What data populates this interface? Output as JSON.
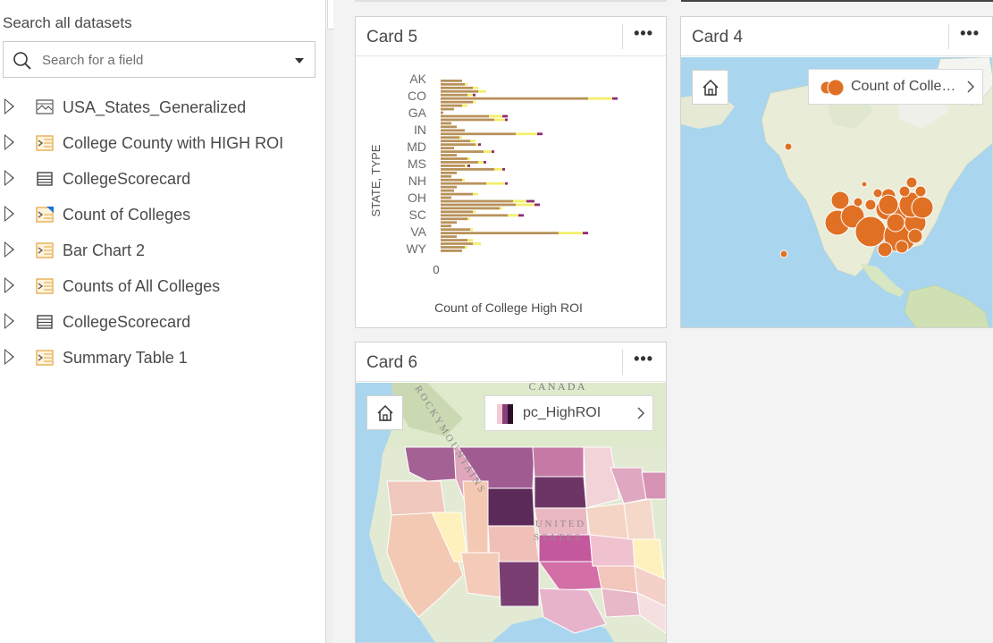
{
  "data_panel": {
    "title": "Search all datasets",
    "search": {
      "placeholder": "Search for a field"
    },
    "datasets": [
      {
        "label": "USA_States_Generalized",
        "icon": "map-layer-icon"
      },
      {
        "label": "College County with HIGH ROI",
        "icon": "result-dataset-icon"
      },
      {
        "label": "CollegeScorecard",
        "icon": "table-dataset-icon"
      },
      {
        "label": "Count of Colleges",
        "icon": "spatial-result-icon"
      },
      {
        "label": "Bar Chart 2",
        "icon": "result-dataset-icon"
      },
      {
        "label": "Counts of All Colleges",
        "icon": "result-dataset-icon"
      },
      {
        "label": "CollegeScorecard",
        "icon": "table-dataset-icon"
      },
      {
        "label": "Summary Table 1",
        "icon": "result-dataset-icon"
      }
    ]
  },
  "cards": {
    "card5": {
      "title": "Card 5",
      "menu": "•••"
    },
    "card4": {
      "title": "Card 4",
      "menu": "•••",
      "legend": "Count of Colle…"
    },
    "card6": {
      "title": "Card 6",
      "menu": "•••",
      "legend": "pc_HighROI"
    }
  },
  "map_labels": {
    "canada": "C A N A D A",
    "united_states": "U N I T E D",
    "states": "S T A T E S",
    "rocky": "R O C K Y   M O U N T A I N S"
  },
  "chart_data": {
    "type": "bar",
    "orientation": "horizontal",
    "stacked": true,
    "xlabel": "Count of College High ROI",
    "ylabel": "STATE, TYPE",
    "x_ticks": [
      "0"
    ],
    "y_tick_labels": [
      "AK",
      "CO",
      "GA",
      "IN",
      "MD",
      "MS",
      "NH",
      "OH",
      "SC",
      "VA",
      "WY"
    ],
    "colors": {
      "primary": "#b8915a",
      "secondary": "#f3ef6a",
      "tertiary": "#8e2a7a"
    },
    "series_values": [
      [
        8,
        0,
        0
      ],
      [
        9,
        1,
        0
      ],
      [
        12,
        2,
        0
      ],
      [
        14,
        3,
        0
      ],
      [
        10,
        2,
        1
      ],
      [
        55,
        9,
        2
      ],
      [
        12,
        1,
        0
      ],
      [
        8,
        2,
        0
      ],
      [
        5,
        0,
        0
      ],
      [
        1,
        0,
        0
      ],
      [
        18,
        5,
        2
      ],
      [
        20,
        4,
        1
      ],
      [
        4,
        0,
        0
      ],
      [
        6,
        0,
        0
      ],
      [
        9,
        0,
        0
      ],
      [
        28,
        8,
        2
      ],
      [
        7,
        1,
        0
      ],
      [
        11,
        2,
        0
      ],
      [
        13,
        1,
        1
      ],
      [
        5,
        0,
        0
      ],
      [
        16,
        3,
        1
      ],
      [
        6,
        0,
        0
      ],
      [
        10,
        1,
        0
      ],
      [
        14,
        2,
        1
      ],
      [
        9,
        1,
        1
      ],
      [
        20,
        3,
        1
      ],
      [
        6,
        0,
        0
      ],
      [
        4,
        0,
        0
      ],
      [
        8,
        1,
        0
      ],
      [
        17,
        7,
        1
      ],
      [
        6,
        0,
        0
      ],
      [
        5,
        0,
        0
      ],
      [
        12,
        2,
        0
      ],
      [
        4,
        0,
        0
      ],
      [
        27,
        5,
        3
      ],
      [
        28,
        7,
        2
      ],
      [
        22,
        1,
        0
      ],
      [
        12,
        1,
        0
      ],
      [
        25,
        4,
        2
      ],
      [
        10,
        1,
        0
      ],
      [
        6,
        0,
        0
      ],
      [
        4,
        0,
        0
      ],
      [
        11,
        1,
        0
      ],
      [
        44,
        9,
        2
      ],
      [
        6,
        0,
        0
      ],
      [
        10,
        2,
        0
      ],
      [
        12,
        3,
        0
      ],
      [
        9,
        1,
        0
      ],
      [
        8,
        0,
        0
      ]
    ]
  }
}
